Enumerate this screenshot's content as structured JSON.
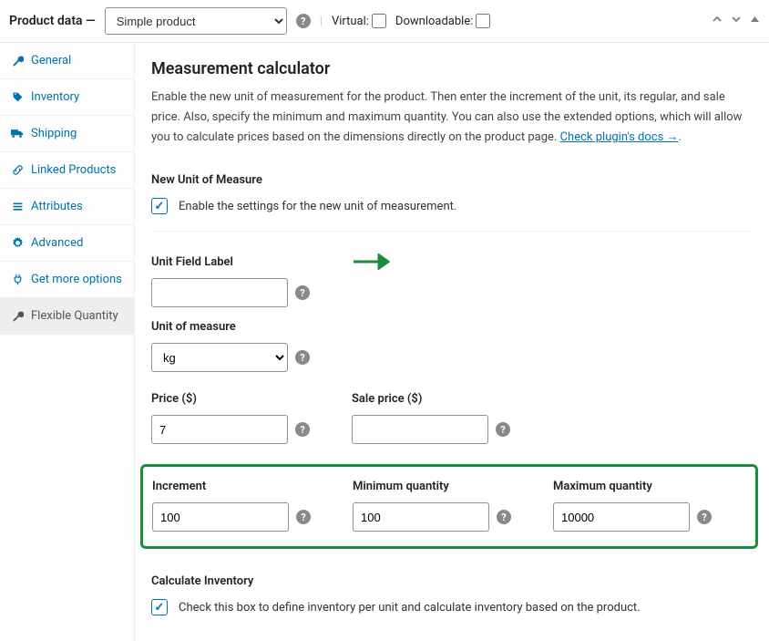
{
  "header": {
    "title": "Product data —",
    "product_type_selected": "Simple product",
    "virtual_label": "Virtual:",
    "downloadable_label": "Downloadable:"
  },
  "sidebar": {
    "items": [
      {
        "icon": "wrench",
        "label": "General"
      },
      {
        "icon": "tag",
        "label": "Inventory"
      },
      {
        "icon": "truck",
        "label": "Shipping"
      },
      {
        "icon": "link",
        "label": "Linked Products"
      },
      {
        "icon": "list",
        "label": "Attributes"
      },
      {
        "icon": "gear",
        "label": "Advanced"
      },
      {
        "icon": "plug",
        "label": "Get more options"
      },
      {
        "icon": "wrench",
        "label": "Flexible Quantity"
      }
    ],
    "active_index": 7
  },
  "content": {
    "title": "Measurement calculator",
    "desc_pre": "Enable the new unit of measurement for the product. Then enter the increment of the unit, its regular, and sale price. Also, specify the minimum and maximum quantity. You can also use the extended options, which will allow you to calculate prices based on the dimensions directly on the product page. ",
    "desc_link": "Check plugin's docs →",
    "new_unit_head": "New Unit of Measure",
    "enable_label": "Enable the settings for the new unit of measurement.",
    "fields": {
      "unit_field_label": {
        "label": "Unit Field Label",
        "value": ""
      },
      "unit_of_measure": {
        "label": "Unit of measure",
        "value": "kg"
      },
      "price": {
        "label": "Price ($)",
        "value": "7"
      },
      "sale_price": {
        "label": "Sale price ($)",
        "value": ""
      },
      "increment": {
        "label": "Increment",
        "value": "100"
      },
      "min_qty": {
        "label": "Minimum quantity",
        "value": "100"
      },
      "max_qty": {
        "label": "Maximum quantity",
        "value": "10000"
      }
    },
    "calc_inv_head": "Calculate Inventory",
    "calc_inv_label": "Check this box to define inventory per unit and calculate inventory based on the product."
  }
}
